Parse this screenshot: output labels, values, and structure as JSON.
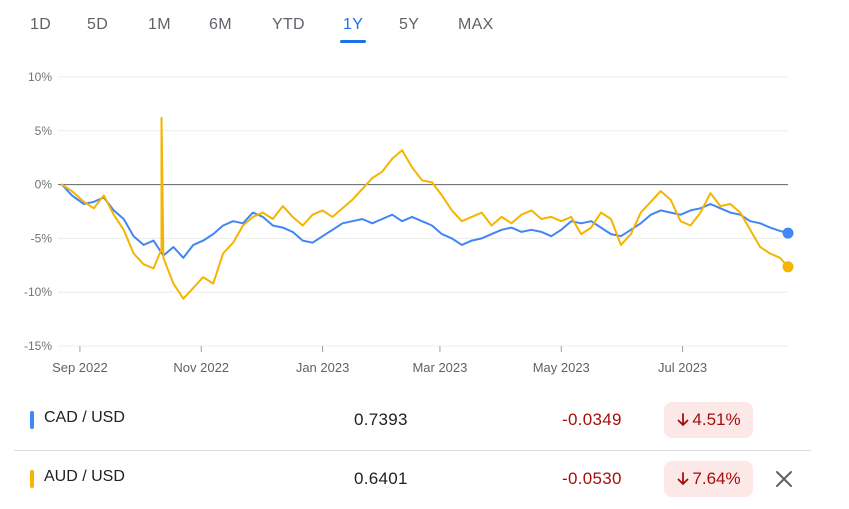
{
  "range_tabs": [
    {
      "label": "1D",
      "active": false
    },
    {
      "label": "5D",
      "active": false
    },
    {
      "label": "1M",
      "active": false
    },
    {
      "label": "6M",
      "active": false
    },
    {
      "label": "YTD",
      "active": false
    },
    {
      "label": "1Y",
      "active": true
    },
    {
      "label": "5Y",
      "active": false
    },
    {
      "label": "MAX",
      "active": false
    }
  ],
  "chart_data": {
    "type": "line",
    "title": "",
    "xlabel": "",
    "ylabel": "",
    "y_unit": "%",
    "ylim": [
      -15,
      10
    ],
    "yticks": [
      "10%",
      "5%",
      "0%",
      "-5%",
      "-10%",
      "-15%"
    ],
    "ytick_values": [
      10,
      5,
      0,
      -5,
      -10,
      -15
    ],
    "xticks": [
      "Sep 2022",
      "Nov 2022",
      "Jan 2023",
      "Mar 2023",
      "May 2023",
      "Jul 2023"
    ],
    "x_domain": [
      "2022-08-23",
      "2023-08-23"
    ],
    "xtick_dates": [
      "2022-09-01",
      "2022-11-01",
      "2023-01-01",
      "2023-03-01",
      "2023-05-01",
      "2023-07-01"
    ],
    "grid": true,
    "baseline": 0,
    "series": [
      {
        "name": "CAD / USD",
        "color": "#4285f4",
        "points": [
          [
            "2022-08-23",
            0
          ],
          [
            "2022-08-28",
            -1.0
          ],
          [
            "2022-09-03",
            -1.8
          ],
          [
            "2022-09-08",
            -1.6
          ],
          [
            "2022-09-13",
            -1.2
          ],
          [
            "2022-09-18",
            -2.4
          ],
          [
            "2022-09-23",
            -3.2
          ],
          [
            "2022-09-28",
            -4.8
          ],
          [
            "2022-10-03",
            -5.6
          ],
          [
            "2022-10-08",
            -5.2
          ],
          [
            "2022-10-13",
            -6.6
          ],
          [
            "2022-10-18",
            -5.8
          ],
          [
            "2022-10-23",
            -6.8
          ],
          [
            "2022-10-28",
            -5.6
          ],
          [
            "2022-11-02",
            -5.2
          ],
          [
            "2022-11-07",
            -4.6
          ],
          [
            "2022-11-12",
            -3.8
          ],
          [
            "2022-11-17",
            -3.4
          ],
          [
            "2022-11-22",
            -3.6
          ],
          [
            "2022-11-27",
            -2.6
          ],
          [
            "2022-12-02",
            -3.0
          ],
          [
            "2022-12-07",
            -3.8
          ],
          [
            "2022-12-12",
            -4.0
          ],
          [
            "2022-12-17",
            -4.4
          ],
          [
            "2022-12-22",
            -5.2
          ],
          [
            "2022-12-27",
            -5.4
          ],
          [
            "2023-01-01",
            -4.8
          ],
          [
            "2023-01-06",
            -4.2
          ],
          [
            "2023-01-11",
            -3.6
          ],
          [
            "2023-01-16",
            -3.4
          ],
          [
            "2023-01-21",
            -3.2
          ],
          [
            "2023-01-26",
            -3.6
          ],
          [
            "2023-01-31",
            -3.2
          ],
          [
            "2023-02-05",
            -2.8
          ],
          [
            "2023-02-10",
            -3.4
          ],
          [
            "2023-02-15",
            -3.0
          ],
          [
            "2023-02-20",
            -3.4
          ],
          [
            "2023-02-25",
            -3.8
          ],
          [
            "2023-03-02",
            -4.6
          ],
          [
            "2023-03-07",
            -5.0
          ],
          [
            "2023-03-12",
            -5.6
          ],
          [
            "2023-03-17",
            -5.2
          ],
          [
            "2023-03-22",
            -5.0
          ],
          [
            "2023-03-27",
            -4.6
          ],
          [
            "2023-04-01",
            -4.2
          ],
          [
            "2023-04-06",
            -4.0
          ],
          [
            "2023-04-11",
            -4.4
          ],
          [
            "2023-04-16",
            -4.2
          ],
          [
            "2023-04-21",
            -4.4
          ],
          [
            "2023-04-26",
            -4.8
          ],
          [
            "2023-05-01",
            -4.2
          ],
          [
            "2023-05-06",
            -3.4
          ],
          [
            "2023-05-11",
            -3.6
          ],
          [
            "2023-05-16",
            -3.4
          ],
          [
            "2023-05-21",
            -4.0
          ],
          [
            "2023-05-26",
            -4.6
          ],
          [
            "2023-05-31",
            -4.8
          ],
          [
            "2023-06-05",
            -4.2
          ],
          [
            "2023-06-10",
            -3.6
          ],
          [
            "2023-06-15",
            -2.8
          ],
          [
            "2023-06-20",
            -2.4
          ],
          [
            "2023-06-25",
            -2.6
          ],
          [
            "2023-06-30",
            -2.8
          ],
          [
            "2023-07-05",
            -2.4
          ],
          [
            "2023-07-10",
            -2.2
          ],
          [
            "2023-07-15",
            -1.8
          ],
          [
            "2023-07-20",
            -2.2
          ],
          [
            "2023-07-25",
            -2.6
          ],
          [
            "2023-07-30",
            -2.8
          ],
          [
            "2023-08-04",
            -3.4
          ],
          [
            "2023-08-09",
            -3.6
          ],
          [
            "2023-08-14",
            -4.0
          ],
          [
            "2023-08-19",
            -4.3
          ],
          [
            "2023-08-23",
            -4.51
          ]
        ]
      },
      {
        "name": "AUD / USD",
        "color": "#f4b400",
        "points": [
          [
            "2022-08-23",
            0
          ],
          [
            "2022-08-28",
            -0.6
          ],
          [
            "2022-09-03",
            -1.6
          ],
          [
            "2022-09-08",
            -2.2
          ],
          [
            "2022-09-13",
            -1.0
          ],
          [
            "2022-09-18",
            -2.8
          ],
          [
            "2022-09-23",
            -4.2
          ],
          [
            "2022-09-28",
            -6.4
          ],
          [
            "2022-10-03",
            -7.4
          ],
          [
            "2022-10-08",
            -7.8
          ],
          [
            "2022-10-12",
            -6.0
          ],
          [
            "2022-10-12",
            6.2
          ],
          [
            "2022-10-13",
            -6.8
          ],
          [
            "2022-10-18",
            -9.2
          ],
          [
            "2022-10-23",
            -10.6
          ],
          [
            "2022-10-28",
            -9.6
          ],
          [
            "2022-11-02",
            -8.6
          ],
          [
            "2022-11-07",
            -9.2
          ],
          [
            "2022-11-12",
            -6.4
          ],
          [
            "2022-11-17",
            -5.4
          ],
          [
            "2022-11-22",
            -3.8
          ],
          [
            "2022-11-27",
            -3.0
          ],
          [
            "2022-12-02",
            -2.6
          ],
          [
            "2022-12-07",
            -3.2
          ],
          [
            "2022-12-12",
            -2.0
          ],
          [
            "2022-12-17",
            -3.0
          ],
          [
            "2022-12-22",
            -3.8
          ],
          [
            "2022-12-27",
            -2.8
          ],
          [
            "2023-01-01",
            -2.4
          ],
          [
            "2023-01-06",
            -3.0
          ],
          [
            "2023-01-11",
            -2.2
          ],
          [
            "2023-01-16",
            -1.4
          ],
          [
            "2023-01-21",
            -0.4
          ],
          [
            "2023-01-26",
            0.6
          ],
          [
            "2023-01-31",
            1.2
          ],
          [
            "2023-02-05",
            2.4
          ],
          [
            "2023-02-10",
            3.2
          ],
          [
            "2023-02-15",
            1.6
          ],
          [
            "2023-02-20",
            0.4
          ],
          [
            "2023-02-25",
            0.2
          ],
          [
            "2023-03-02",
            -1.0
          ],
          [
            "2023-03-07",
            -2.4
          ],
          [
            "2023-03-12",
            -3.4
          ],
          [
            "2023-03-17",
            -3.0
          ],
          [
            "2023-03-22",
            -2.6
          ],
          [
            "2023-03-27",
            -3.8
          ],
          [
            "2023-04-01",
            -3.0
          ],
          [
            "2023-04-06",
            -3.6
          ],
          [
            "2023-04-11",
            -2.8
          ],
          [
            "2023-04-16",
            -2.4
          ],
          [
            "2023-04-21",
            -3.2
          ],
          [
            "2023-04-26",
            -3.0
          ],
          [
            "2023-05-01",
            -3.4
          ],
          [
            "2023-05-06",
            -3.0
          ],
          [
            "2023-05-11",
            -4.6
          ],
          [
            "2023-05-16",
            -4.0
          ],
          [
            "2023-05-21",
            -2.6
          ],
          [
            "2023-05-26",
            -3.2
          ],
          [
            "2023-05-31",
            -5.6
          ],
          [
            "2023-06-05",
            -4.6
          ],
          [
            "2023-06-10",
            -2.6
          ],
          [
            "2023-06-15",
            -1.6
          ],
          [
            "2023-06-20",
            -0.6
          ],
          [
            "2023-06-25",
            -1.4
          ],
          [
            "2023-06-30",
            -3.4
          ],
          [
            "2023-07-05",
            -3.8
          ],
          [
            "2023-07-10",
            -2.6
          ],
          [
            "2023-07-15",
            -0.8
          ],
          [
            "2023-07-20",
            -2.0
          ],
          [
            "2023-07-25",
            -1.8
          ],
          [
            "2023-07-30",
            -2.6
          ],
          [
            "2023-08-04",
            -4.2
          ],
          [
            "2023-08-09",
            -5.8
          ],
          [
            "2023-08-14",
            -6.4
          ],
          [
            "2023-08-19",
            -6.8
          ],
          [
            "2023-08-23",
            -7.64
          ]
        ]
      }
    ]
  },
  "rows": [
    {
      "pair": "CAD / USD",
      "price": "0.7393",
      "change": "-0.0349",
      "percent": "4.51%",
      "color": "#4285f4"
    },
    {
      "pair": "AUD / USD",
      "price": "0.6401",
      "change": "-0.0530",
      "percent": "7.64%",
      "color": "#f4b400"
    }
  ],
  "colors": {
    "accent": "#1a73e8",
    "negative_text": "#a50e0e",
    "negative_bg": "#fce8e6"
  },
  "icons": {
    "down_arrow": "arrow-down-icon",
    "close": "close-icon"
  }
}
